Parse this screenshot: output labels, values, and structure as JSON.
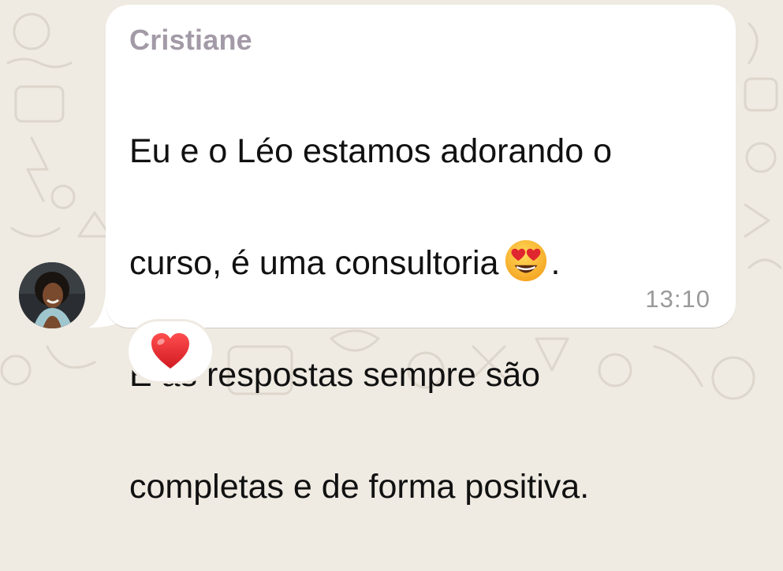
{
  "message": {
    "sender_name": "Cristiane",
    "text_lines": [
      "Eu e o Léo estamos adorando o",
      "curso, é uma consultoria",
      "E as respostas sempre são",
      "completas e de forma positiva."
    ],
    "line2_suffix": ".",
    "inline_emoji": "heart-eyes-emoji",
    "timestamp": "13:10",
    "reaction": "red-heart-emoji"
  },
  "colors": {
    "background": "#efeae2",
    "bubble": "#ffffff",
    "sender_name": "#a39aa7",
    "text": "#111111",
    "timestamp": "#9a9a9a",
    "heart": "#e0262f"
  }
}
